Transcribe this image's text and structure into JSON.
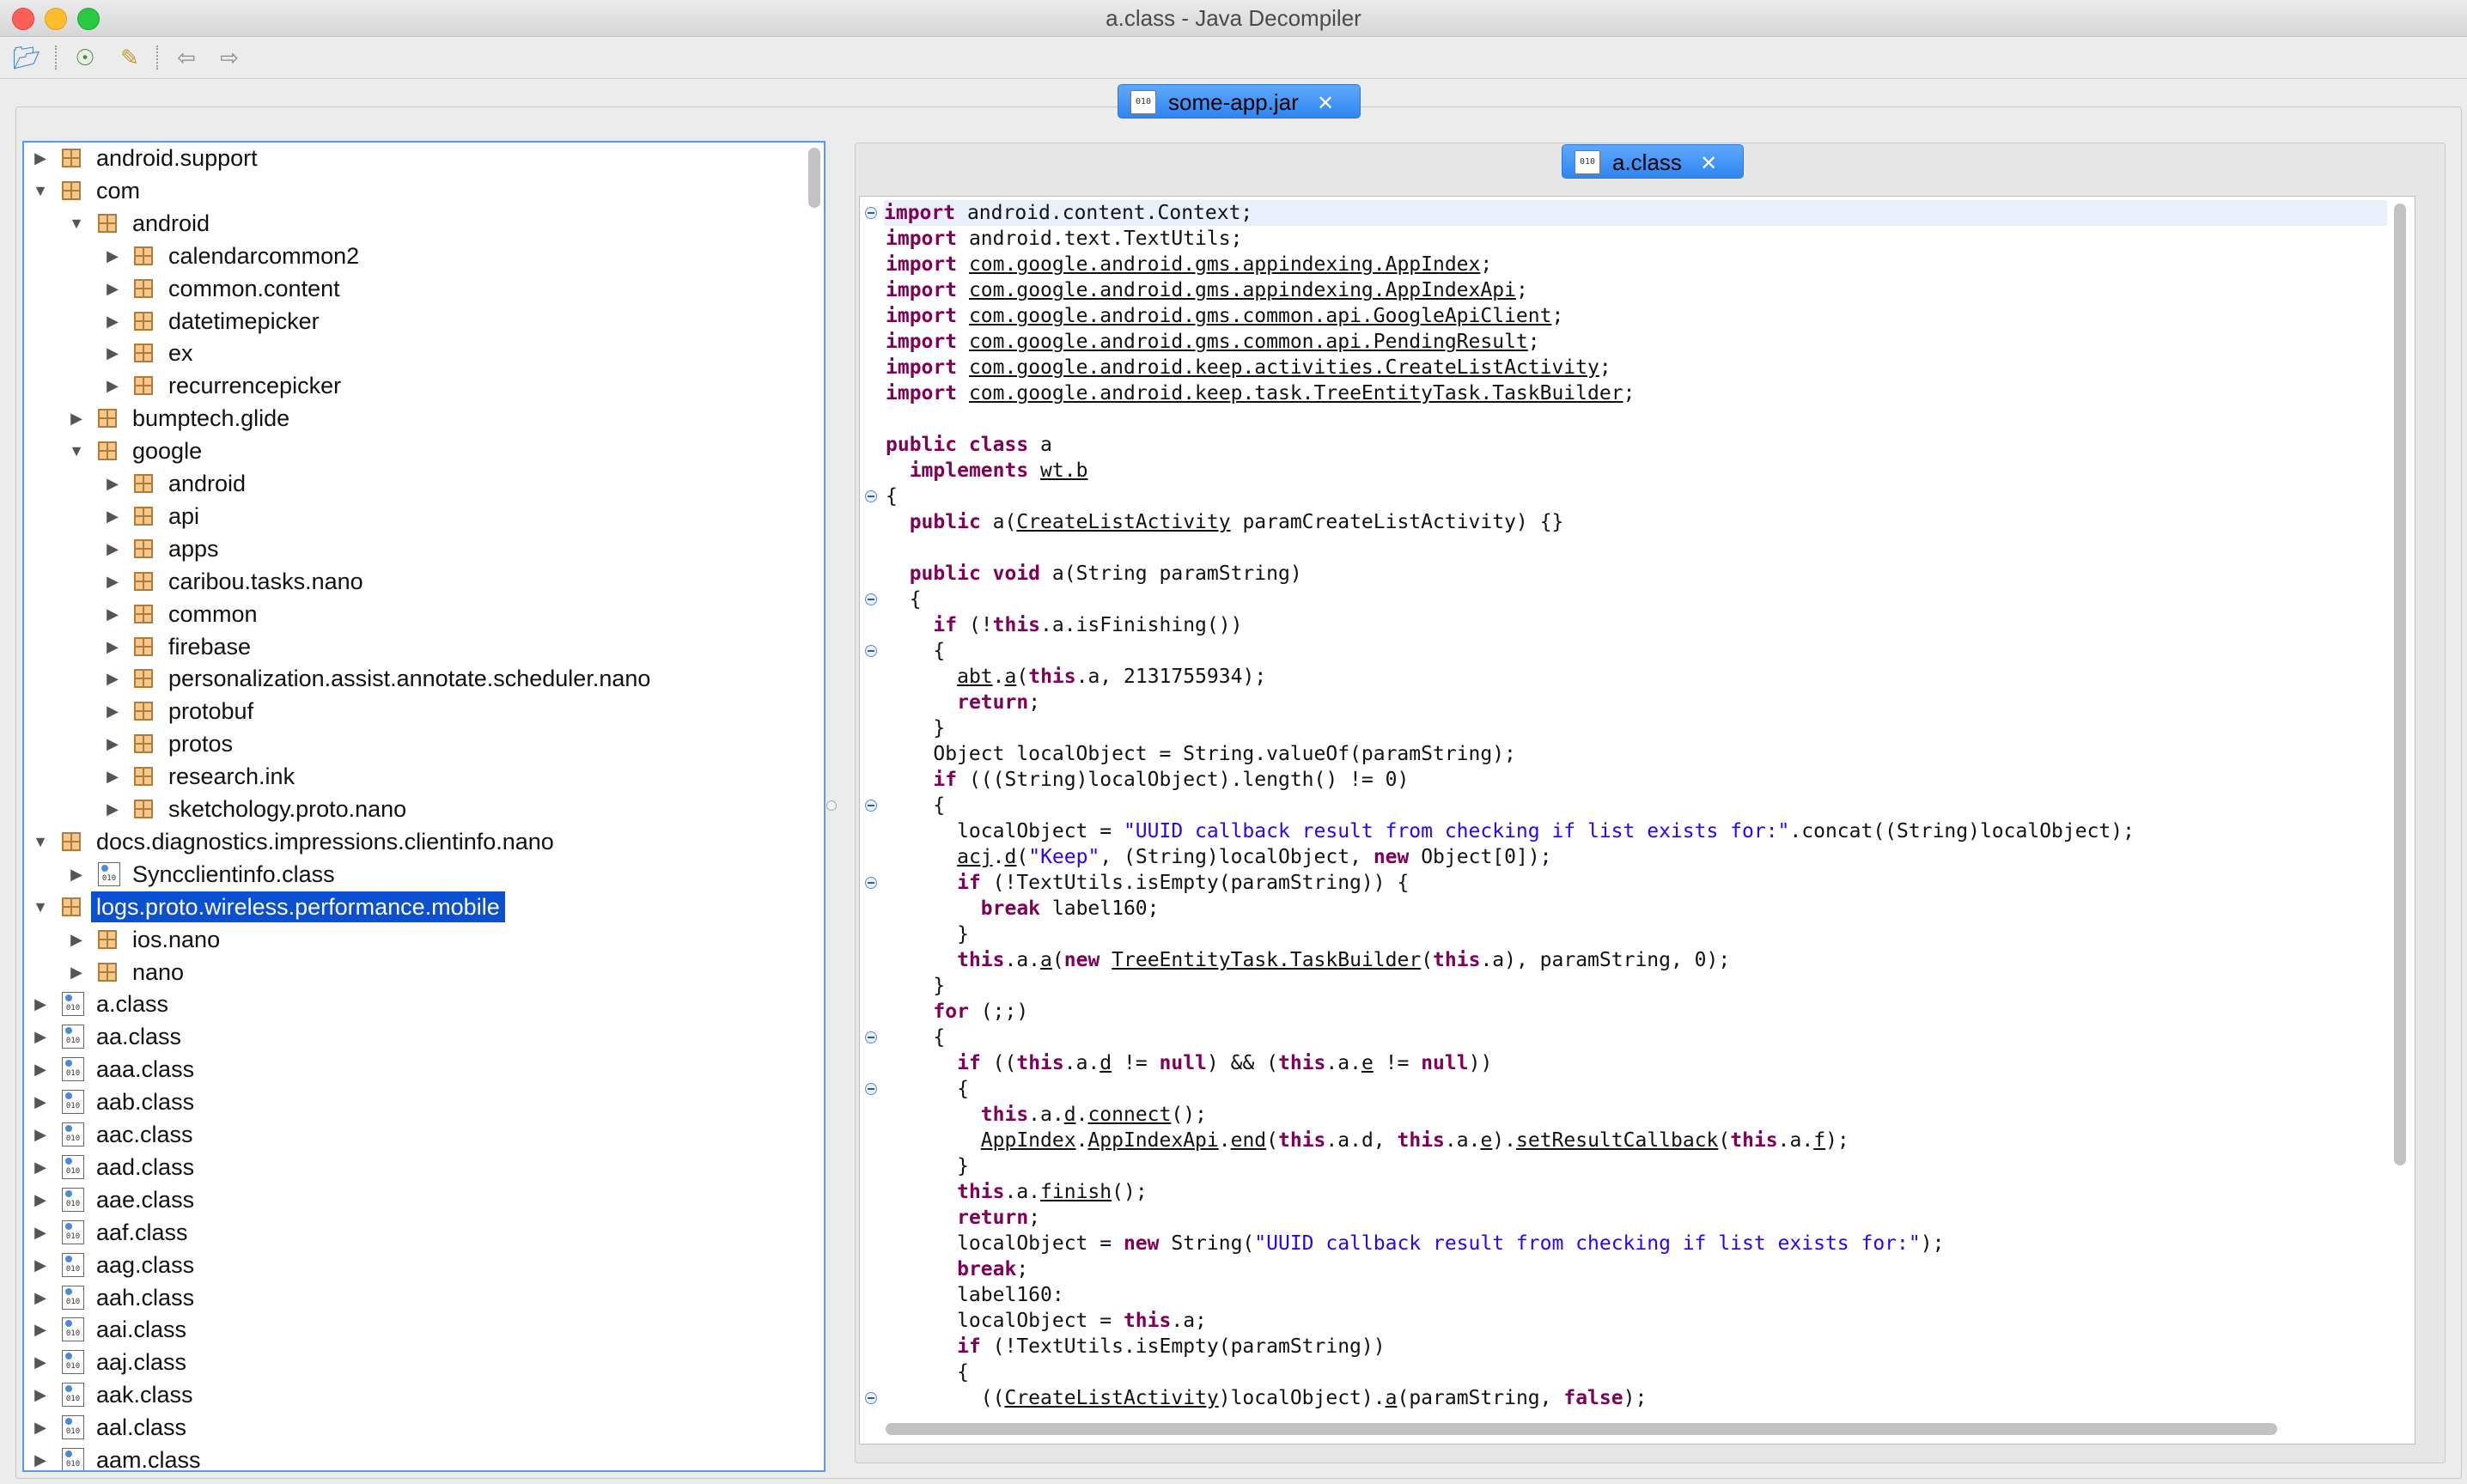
{
  "window": {
    "title": "a.class - Java Decompiler"
  },
  "toolbar": {
    "open": "open-file-icon",
    "browse": "open-type-icon",
    "search": "search-icon",
    "back": "back-arrow-icon",
    "forward": "forward-arrow-icon"
  },
  "tabs": {
    "jar": {
      "label": "some-app.jar",
      "close": "✕"
    },
    "class": {
      "label": "a.class",
      "close": "✕"
    }
  },
  "tree": {
    "items": [
      {
        "label": "android.support",
        "level": 0,
        "expanded": false,
        "kind": "package"
      },
      {
        "label": "com",
        "level": 0,
        "expanded": true,
        "kind": "package"
      },
      {
        "label": "android",
        "level": 1,
        "expanded": true,
        "kind": "package"
      },
      {
        "label": "calendarcommon2",
        "level": 2,
        "expanded": false,
        "kind": "package"
      },
      {
        "label": "common.content",
        "level": 2,
        "expanded": false,
        "kind": "package"
      },
      {
        "label": "datetimepicker",
        "level": 2,
        "expanded": false,
        "kind": "package"
      },
      {
        "label": "ex",
        "level": 2,
        "expanded": false,
        "kind": "package"
      },
      {
        "label": "recurrencepicker",
        "level": 2,
        "expanded": false,
        "kind": "package"
      },
      {
        "label": "bumptech.glide",
        "level": 1,
        "expanded": false,
        "kind": "package"
      },
      {
        "label": "google",
        "level": 1,
        "expanded": true,
        "kind": "package"
      },
      {
        "label": "android",
        "level": 2,
        "expanded": false,
        "kind": "package"
      },
      {
        "label": "api",
        "level": 2,
        "expanded": false,
        "kind": "package"
      },
      {
        "label": "apps",
        "level": 2,
        "expanded": false,
        "kind": "package"
      },
      {
        "label": "caribou.tasks.nano",
        "level": 2,
        "expanded": false,
        "kind": "package"
      },
      {
        "label": "common",
        "level": 2,
        "expanded": false,
        "kind": "package"
      },
      {
        "label": "firebase",
        "level": 2,
        "expanded": false,
        "kind": "package"
      },
      {
        "label": "personalization.assist.annotate.scheduler.nano",
        "level": 2,
        "expanded": false,
        "kind": "package"
      },
      {
        "label": "protobuf",
        "level": 2,
        "expanded": false,
        "kind": "package"
      },
      {
        "label": "protos",
        "level": 2,
        "expanded": false,
        "kind": "package"
      },
      {
        "label": "research.ink",
        "level": 2,
        "expanded": false,
        "kind": "package"
      },
      {
        "label": "sketchology.proto.nano",
        "level": 2,
        "expanded": false,
        "kind": "package"
      },
      {
        "label": "docs.diagnostics.impressions.clientinfo.nano",
        "level": 0,
        "expanded": true,
        "kind": "package"
      },
      {
        "label": "Syncclientinfo.class",
        "level": 1,
        "expanded": false,
        "kind": "class"
      },
      {
        "label": "logs.proto.wireless.performance.mobile",
        "level": 0,
        "expanded": true,
        "kind": "package",
        "selected": true
      },
      {
        "label": "ios.nano",
        "level": 1,
        "expanded": false,
        "kind": "package"
      },
      {
        "label": "nano",
        "level": 1,
        "expanded": false,
        "kind": "package"
      },
      {
        "label": "a.class",
        "level": 0,
        "expanded": false,
        "kind": "class"
      },
      {
        "label": "aa.class",
        "level": 0,
        "expanded": false,
        "kind": "class"
      },
      {
        "label": "aaa.class",
        "level": 0,
        "expanded": false,
        "kind": "class"
      },
      {
        "label": "aab.class",
        "level": 0,
        "expanded": false,
        "kind": "class"
      },
      {
        "label": "aac.class",
        "level": 0,
        "expanded": false,
        "kind": "class"
      },
      {
        "label": "aad.class",
        "level": 0,
        "expanded": false,
        "kind": "class"
      },
      {
        "label": "aae.class",
        "level": 0,
        "expanded": false,
        "kind": "class"
      },
      {
        "label": "aaf.class",
        "level": 0,
        "expanded": false,
        "kind": "class"
      },
      {
        "label": "aag.class",
        "level": 0,
        "expanded": false,
        "kind": "class"
      },
      {
        "label": "aah.class",
        "level": 0,
        "expanded": false,
        "kind": "class"
      },
      {
        "label": "aai.class",
        "level": 0,
        "expanded": false,
        "kind": "class"
      },
      {
        "label": "aaj.class",
        "level": 0,
        "expanded": false,
        "kind": "class"
      },
      {
        "label": "aak.class",
        "level": 0,
        "expanded": false,
        "kind": "class"
      },
      {
        "label": "aal.class",
        "level": 0,
        "expanded": false,
        "kind": "class"
      },
      {
        "label": "aam.class",
        "level": 0,
        "expanded": false,
        "kind": "class"
      }
    ]
  },
  "code": {
    "fold_lines": [
      0,
      11,
      15,
      17,
      23,
      26,
      32,
      34,
      46
    ],
    "lines": [
      [
        [
          "kw",
          "import"
        ],
        [
          "t",
          " android.content.Context;"
        ]
      ],
      [
        [
          "kw",
          "import"
        ],
        [
          "t",
          " android.text.TextUtils;"
        ]
      ],
      [
        [
          "kw",
          "import"
        ],
        [
          "t",
          " "
        ],
        [
          "u",
          "com.google.android.gms.appindexing.AppIndex"
        ],
        [
          "t",
          ";"
        ]
      ],
      [
        [
          "kw",
          "import"
        ],
        [
          "t",
          " "
        ],
        [
          "u",
          "com.google.android.gms.appindexing.AppIndexApi"
        ],
        [
          "t",
          ";"
        ]
      ],
      [
        [
          "kw",
          "import"
        ],
        [
          "t",
          " "
        ],
        [
          "u",
          "com.google.android.gms.common.api.GoogleApiClient"
        ],
        [
          "t",
          ";"
        ]
      ],
      [
        [
          "kw",
          "import"
        ],
        [
          "t",
          " "
        ],
        [
          "u",
          "com.google.android.gms.common.api.PendingResult"
        ],
        [
          "t",
          ";"
        ]
      ],
      [
        [
          "kw",
          "import"
        ],
        [
          "t",
          " "
        ],
        [
          "u",
          "com.google.android.keep.activities.CreateListActivity"
        ],
        [
          "t",
          ";"
        ]
      ],
      [
        [
          "kw",
          "import"
        ],
        [
          "t",
          " "
        ],
        [
          "u",
          "com.google.android.keep.task.TreeEntityTask.TaskBuilder"
        ],
        [
          "t",
          ";"
        ]
      ],
      [
        [
          "t",
          ""
        ]
      ],
      [
        [
          "kw",
          "public class"
        ],
        [
          "t",
          " a"
        ]
      ],
      [
        [
          "t",
          "  "
        ],
        [
          "kw",
          "implements"
        ],
        [
          "t",
          " "
        ],
        [
          "u",
          "wt.b"
        ]
      ],
      [
        [
          "t",
          "{"
        ]
      ],
      [
        [
          "t",
          "  "
        ],
        [
          "kw",
          "public"
        ],
        [
          "t",
          " a("
        ],
        [
          "u",
          "CreateListActivity"
        ],
        [
          "t",
          " paramCreateListActivity) {}"
        ]
      ],
      [
        [
          "t",
          ""
        ]
      ],
      [
        [
          "t",
          "  "
        ],
        [
          "kw",
          "public void"
        ],
        [
          "t",
          " a(String paramString)"
        ]
      ],
      [
        [
          "t",
          "  {"
        ]
      ],
      [
        [
          "t",
          "    "
        ],
        [
          "kw",
          "if"
        ],
        [
          "t",
          " (!"
        ],
        [
          "kw",
          "this"
        ],
        [
          "t",
          ".a.isFinishing())"
        ]
      ],
      [
        [
          "t",
          "    {"
        ]
      ],
      [
        [
          "t",
          "      "
        ],
        [
          "u",
          "abt"
        ],
        [
          "t",
          "."
        ],
        [
          "u",
          "a"
        ],
        [
          "t",
          "("
        ],
        [
          "kw",
          "this"
        ],
        [
          "t",
          ".a, 2131755934);"
        ]
      ],
      [
        [
          "t",
          "      "
        ],
        [
          "kw",
          "return"
        ],
        [
          "t",
          ";"
        ]
      ],
      [
        [
          "t",
          "    }"
        ]
      ],
      [
        [
          "t",
          "    Object localObject = String.valueOf(paramString);"
        ]
      ],
      [
        [
          "t",
          "    "
        ],
        [
          "kw",
          "if"
        ],
        [
          "t",
          " (((String)localObject).length() != 0)"
        ]
      ],
      [
        [
          "t",
          "    {"
        ]
      ],
      [
        [
          "t",
          "      localObject = "
        ],
        [
          "str",
          "\"UUID callback result from checking if list exists for:\""
        ],
        [
          "t",
          ".concat((String)localObject);"
        ]
      ],
      [
        [
          "t",
          "      "
        ],
        [
          "u",
          "acj"
        ],
        [
          "t",
          "."
        ],
        [
          "u",
          "d"
        ],
        [
          "t",
          "("
        ],
        [
          "str",
          "\"Keep\""
        ],
        [
          "t",
          ", (String)localObject, "
        ],
        [
          "kw",
          "new"
        ],
        [
          "t",
          " Object[0]);"
        ]
      ],
      [
        [
          "t",
          "      "
        ],
        [
          "kw",
          "if"
        ],
        [
          "t",
          " (!TextUtils.isEmpty(paramString)) {"
        ]
      ],
      [
        [
          "t",
          "        "
        ],
        [
          "kw",
          "break"
        ],
        [
          "t",
          " label160;"
        ]
      ],
      [
        [
          "t",
          "      }"
        ]
      ],
      [
        [
          "t",
          "      "
        ],
        [
          "kw",
          "this"
        ],
        [
          "t",
          ".a."
        ],
        [
          "u",
          "a"
        ],
        [
          "t",
          "("
        ],
        [
          "kw",
          "new"
        ],
        [
          "t",
          " "
        ],
        [
          "u",
          "TreeEntityTask.TaskBuilder"
        ],
        [
          "t",
          "("
        ],
        [
          "kw",
          "this"
        ],
        [
          "t",
          ".a), paramString, 0);"
        ]
      ],
      [
        [
          "t",
          "    }"
        ]
      ],
      [
        [
          "t",
          "    "
        ],
        [
          "kw",
          "for"
        ],
        [
          "t",
          " (;;)"
        ]
      ],
      [
        [
          "t",
          "    {"
        ]
      ],
      [
        [
          "t",
          "      "
        ],
        [
          "kw",
          "if"
        ],
        [
          "t",
          " (("
        ],
        [
          "kw",
          "this"
        ],
        [
          "t",
          ".a."
        ],
        [
          "u",
          "d"
        ],
        [
          "t",
          " != "
        ],
        [
          "kw",
          "null"
        ],
        [
          "t",
          ") && ("
        ],
        [
          "kw",
          "this"
        ],
        [
          "t",
          ".a."
        ],
        [
          "u",
          "e"
        ],
        [
          "t",
          " != "
        ],
        [
          "kw",
          "null"
        ],
        [
          "t",
          "))"
        ]
      ],
      [
        [
          "t",
          "      {"
        ]
      ],
      [
        [
          "t",
          "        "
        ],
        [
          "kw",
          "this"
        ],
        [
          "t",
          ".a."
        ],
        [
          "u",
          "d"
        ],
        [
          "t",
          "."
        ],
        [
          "u",
          "connect"
        ],
        [
          "t",
          "();"
        ]
      ],
      [
        [
          "t",
          "        "
        ],
        [
          "u",
          "AppIndex"
        ],
        [
          "t",
          "."
        ],
        [
          "u",
          "AppIndexApi"
        ],
        [
          "t",
          "."
        ],
        [
          "u",
          "end"
        ],
        [
          "t",
          "("
        ],
        [
          "kw",
          "this"
        ],
        [
          "t",
          ".a.d, "
        ],
        [
          "kw",
          "this"
        ],
        [
          "t",
          ".a."
        ],
        [
          "u",
          "e"
        ],
        [
          "t",
          ")."
        ],
        [
          "u",
          "setResultCallback"
        ],
        [
          "t",
          "("
        ],
        [
          "kw",
          "this"
        ],
        [
          "t",
          ".a."
        ],
        [
          "u",
          "f"
        ],
        [
          "t",
          ");"
        ]
      ],
      [
        [
          "t",
          "      }"
        ]
      ],
      [
        [
          "t",
          "      "
        ],
        [
          "kw",
          "this"
        ],
        [
          "t",
          ".a."
        ],
        [
          "u",
          "finish"
        ],
        [
          "t",
          "();"
        ]
      ],
      [
        [
          "t",
          "      "
        ],
        [
          "kw",
          "return"
        ],
        [
          "t",
          ";"
        ]
      ],
      [
        [
          "t",
          "      localObject = "
        ],
        [
          "kw",
          "new"
        ],
        [
          "t",
          " String("
        ],
        [
          "str",
          "\"UUID callback result from checking if list exists for:\""
        ],
        [
          "t",
          ");"
        ]
      ],
      [
        [
          "t",
          "      "
        ],
        [
          "kw",
          "break"
        ],
        [
          "t",
          ";"
        ]
      ],
      [
        [
          "t",
          "      label160:"
        ]
      ],
      [
        [
          "t",
          "      localObject = "
        ],
        [
          "kw",
          "this"
        ],
        [
          "t",
          ".a;"
        ]
      ],
      [
        [
          "t",
          "      "
        ],
        [
          "kw",
          "if"
        ],
        [
          "t",
          " (!TextUtils.isEmpty(paramString))"
        ]
      ],
      [
        [
          "t",
          "      {"
        ]
      ],
      [
        [
          "t",
          "        (("
        ],
        [
          "u",
          "CreateListActivity"
        ],
        [
          "t",
          ")localObject)."
        ],
        [
          "u",
          "a"
        ],
        [
          "t",
          "(paramString, "
        ],
        [
          "kw",
          "false"
        ],
        [
          "t",
          ");"
        ]
      ]
    ]
  }
}
